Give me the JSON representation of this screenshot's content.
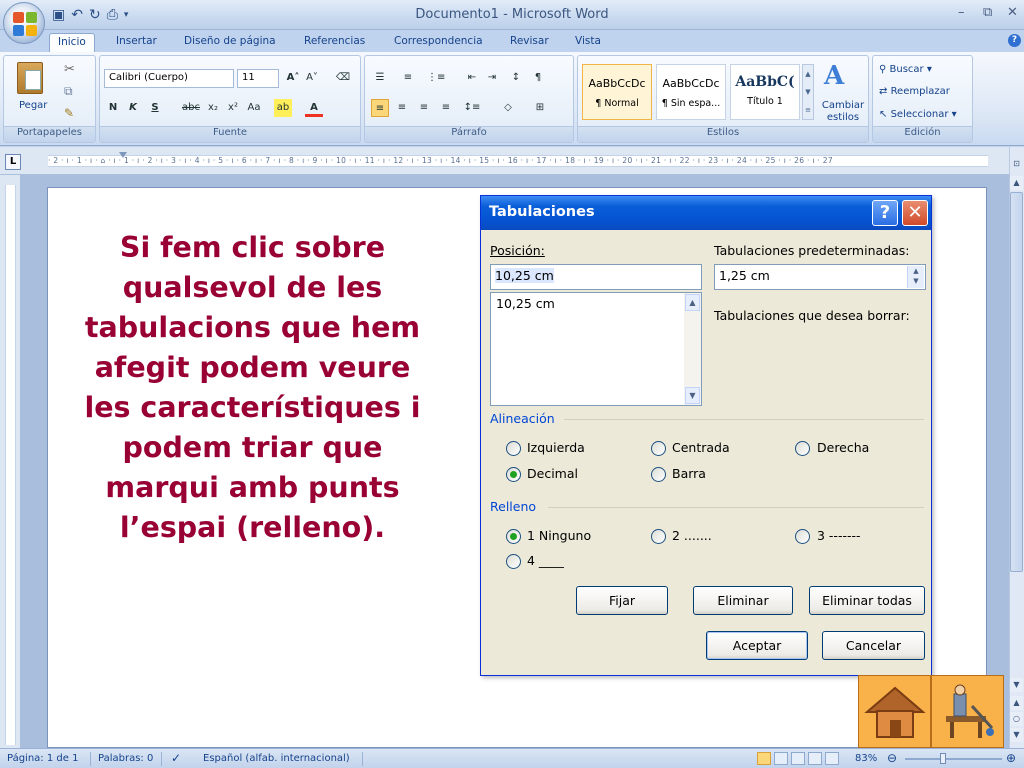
{
  "window": {
    "title": "Documento1 - Microsoft Word",
    "minimize": "–",
    "restore": "⧉",
    "close": "✕",
    "help": "?"
  },
  "tabs": [
    "Inicio",
    "Insertar",
    "Diseño de página",
    "Referencias",
    "Correspondencia",
    "Revisar",
    "Vista"
  ],
  "ribbon": {
    "clipboard": {
      "label": "Portapapeles",
      "paste": "Pegar"
    },
    "font": {
      "label": "Fuente",
      "name": "Calibri (Cuerpo)",
      "size": "11"
    },
    "paragraph": {
      "label": "Párrafo"
    },
    "styles": {
      "label": "Estilos",
      "items": [
        {
          "sample": "AaBbCcDc",
          "name": "¶ Normal"
        },
        {
          "sample": "AaBbCcDc",
          "name": "¶ Sin espa..."
        },
        {
          "sample": "AaBbC(",
          "name": "Título 1"
        }
      ],
      "change": "Cambiar estilos"
    },
    "editing": {
      "label": "Edición",
      "find": "Buscar",
      "replace": "Reemplazar",
      "select": "Seleccionar"
    }
  },
  "ruler": {
    "numbers": "· 2 · ı · 1 · ı · ⌂ · ı · 1 · ı · 2 · ı · 3 · ı · 4 · ı · 5 · ı · 6 · ı · 7 · ı · 8 · ı · 9 · ı · 10 · ı · 11 · ı · 12 · ı · 13 · ı · 14 · ı · 15 · ı · 16 · ı · 17 · ı · 18 · ı · 19 · ı · 20 · ı · 21 · ı · 22 · ı · 23 · ı · 24 · ı · 25 · ı · 26 · ı · 27"
  },
  "document": {
    "caption": "Si fem clic sobre qualsevol de les tabulacions que hem afegit podem veure les característiques i podem triar que marqui amb punts l’espai (relleno)."
  },
  "dialog": {
    "title": "Tabulaciones",
    "position_label": "Posición:",
    "position_value": "10,25 cm",
    "position_list": [
      "10,25 cm"
    ],
    "default_tabs_label": "Tabulaciones predeterminadas:",
    "default_tabs_value": "1,25 cm",
    "clear_label": "Tabulaciones que desea borrar:",
    "alignment_label": "Alineación",
    "alignment_options": [
      "Izquierda",
      "Centrada",
      "Derecha",
      "Decimal",
      "Barra"
    ],
    "alignment_selected": "Decimal",
    "leader_label": "Relleno",
    "leader_options": [
      "1 Ninguno",
      "2 .......",
      "3 -------",
      "4 ____"
    ],
    "leader_selected": "1 Ninguno",
    "buttons": {
      "set": "Fijar",
      "clear": "Eliminar",
      "clear_all": "Eliminar todas",
      "ok": "Aceptar",
      "cancel": "Cancelar"
    }
  },
  "status": {
    "page": "Página: 1 de 1",
    "words": "Palabras: 0",
    "language": "Español (alfab. internacional)",
    "zoom": "83%"
  },
  "colors": {
    "caption": "#990033",
    "dialog_title": "#0553d2",
    "nav_bg": "#f9b24a"
  }
}
